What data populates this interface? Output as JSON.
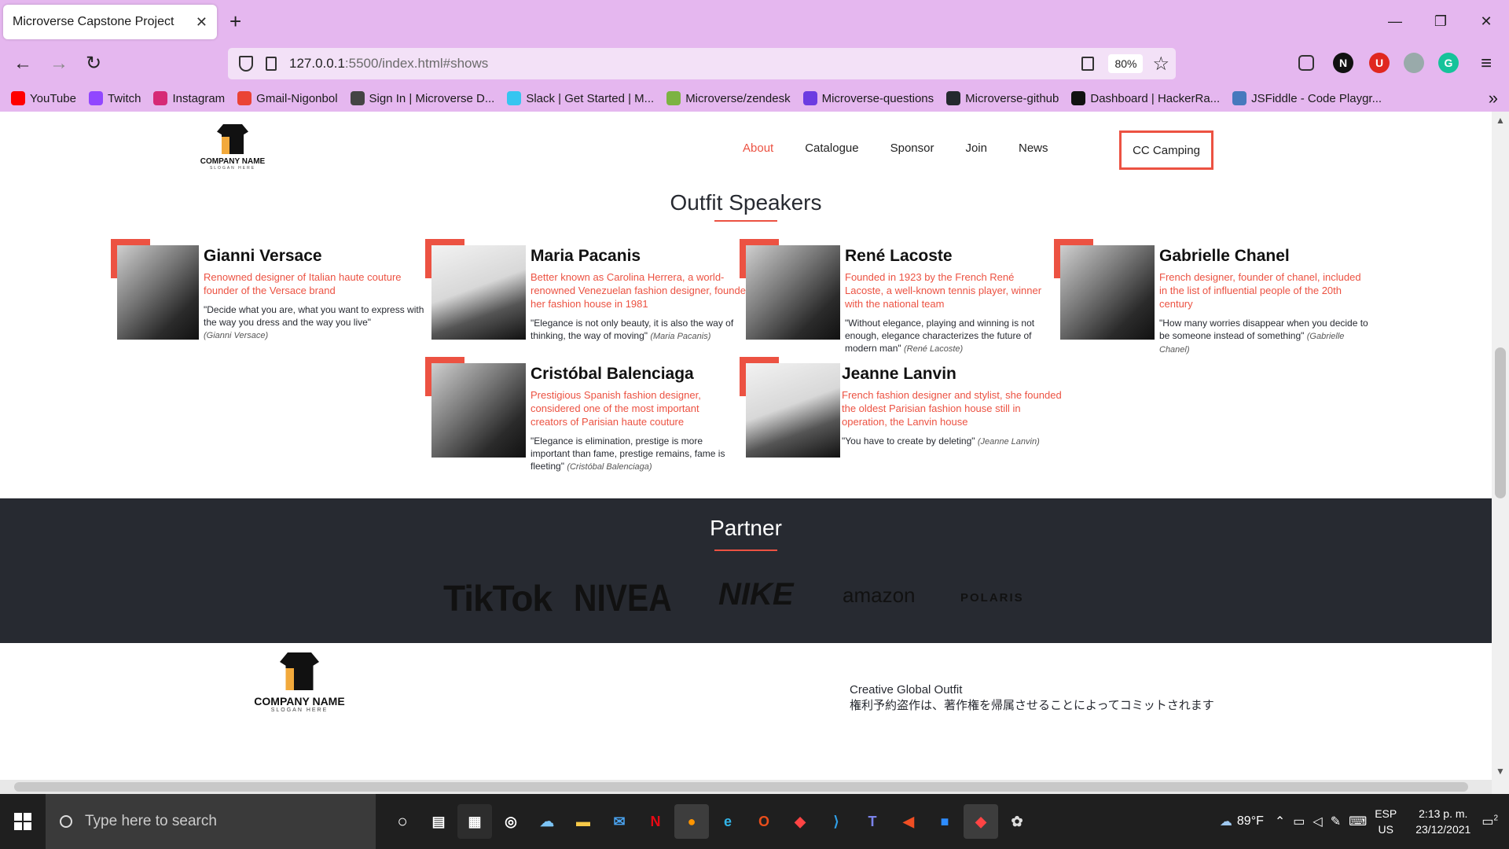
{
  "browser": {
    "tab_title": "Microverse Capstone Project",
    "url_host": "127.0.0.1",
    "url_path": ":5500/index.html#shows",
    "zoom": "80%",
    "bookmarks": [
      {
        "label": "YouTube",
        "color": "#ff0000"
      },
      {
        "label": "Twitch",
        "color": "#9146ff"
      },
      {
        "label": "Instagram",
        "color": "#d62976"
      },
      {
        "label": "Gmail-Nigonbol",
        "color": "#ea4335"
      },
      {
        "label": "Sign In | Microverse D...",
        "color": "#444444"
      },
      {
        "label": "Slack | Get Started | M...",
        "color": "#36c5f0"
      },
      {
        "label": "Microverse/zendesk",
        "color": "#7cb342"
      },
      {
        "label": "Microverse-questions",
        "color": "#6c3ce1"
      },
      {
        "label": "Microverse-github",
        "color": "#24292e"
      },
      {
        "label": "Dashboard | HackerRa...",
        "color": "#111111"
      },
      {
        "label": "JSFiddle - Code Playgr...",
        "color": "#4679bd"
      }
    ]
  },
  "site": {
    "logo": {
      "name": "COMPANY NAME",
      "slogan": "SLOGAN HERE"
    },
    "menu": [
      "About",
      "Catalogue",
      "Sponsor",
      "Join",
      "News"
    ],
    "cta": "CC Camping",
    "speakers_title": "Outfit Speakers",
    "speakers": [
      {
        "name": "Gianni Versace",
        "role": "Renowned designer of Italian haute couture founder of the Versace brand",
        "quote": "\"Decide what you are, what you want to express with the way you dress and the way you live\"",
        "author": "(Gianni Versace)"
      },
      {
        "name": "Maria Pacanis",
        "role": "Better known as Carolina Herrera, a world-renowned Venezuelan fashion designer, founded her fashion house in 1981",
        "quote": "\"Elegance is not only beauty, it is also the way of thinking, the way of moving\"",
        "author": "(Maria Pacanis)"
      },
      {
        "name": "René Lacoste",
        "role": "Founded in 1923 by the French René Lacoste, a well-known tennis player, winner with the national team",
        "quote": "\"Without elegance, playing and winning is not enough, elegance characterizes the future of modern man\"",
        "author": "(René Lacoste)"
      },
      {
        "name": "Gabrielle Chanel",
        "role": "French designer, founder of chanel, included in the list of influential people of the 20th century",
        "quote": "\"How many worries disappear when you decide to be someone instead of something\"",
        "author": "(Gabrielle Chanel)"
      },
      {
        "name": "Cristóbal Balenciaga",
        "role": "Prestigious Spanish fashion designer, considered one of the most important creators of Parisian haute couture",
        "quote": "\"Elegance is elimination, prestige is more important than fame, prestige remains, fame is fleeting\"",
        "author": "(Cristóbal Balenciaga)"
      },
      {
        "name": "Jeanne Lanvin",
        "role": "French fashion designer and stylist, she founded the oldest Parisian fashion house still in operation, the Lanvin house",
        "quote": "\"You have to create by deleting\"",
        "author": "(Jeanne Lanvin)"
      }
    ],
    "partner_title": "Partner",
    "partners": [
      "TikTok",
      "NIVEA",
      "NIKE",
      "amazon",
      "POLARIS"
    ],
    "footer": {
      "line1": "Creative Global Outfit",
      "line2": "権利予約盗作は、著作権を帰属させることによってコミットされます"
    }
  },
  "taskbar": {
    "search_placeholder": "Type here to search",
    "weather": "89°F",
    "lang1": "ESP",
    "lang2": "US",
    "time": "2:13 p. m.",
    "date": "23/12/2021",
    "notifications": "2"
  }
}
